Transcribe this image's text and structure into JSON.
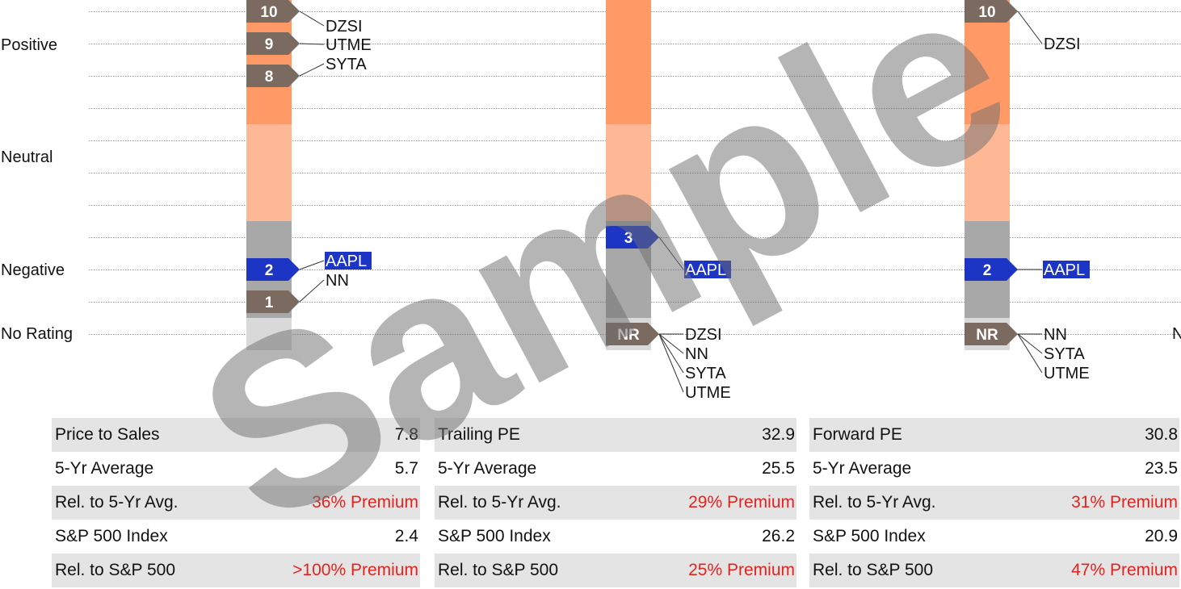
{
  "chart_data": {
    "type": "valuation-rating-columns",
    "rating_labels": [
      "Positive",
      "Neutral",
      "Negative",
      "No Rating"
    ],
    "cut_left": "N",
    "columns": [
      {
        "markers": [
          {
            "label": "10",
            "value": 10,
            "kind": "brown",
            "tickers": [
              "DZSI"
            ]
          },
          {
            "label": "9",
            "value": 9,
            "kind": "brown",
            "tickers": [
              "UTME"
            ]
          },
          {
            "label": "8",
            "value": 8,
            "kind": "brown",
            "tickers": [
              "SYTA"
            ]
          },
          {
            "label": "2",
            "value": 2,
            "kind": "blue",
            "tickers": [
              "AAPL"
            ]
          },
          {
            "label": "1",
            "value": 1,
            "kind": "brown",
            "tickers": [
              "NN"
            ]
          }
        ]
      },
      {
        "markers": [
          {
            "label": "3",
            "value": 3,
            "kind": "blue",
            "tickers": [
              "AAPL"
            ]
          },
          {
            "label": "NR",
            "value": 0,
            "kind": "brown",
            "tickers": [
              "DZSI",
              "NN",
              "SYTA",
              "UTME"
            ]
          }
        ]
      },
      {
        "markers": [
          {
            "label": "10",
            "value": 10,
            "kind": "brown",
            "tickers": [
              "DZSI"
            ]
          },
          {
            "label": "2",
            "value": 2,
            "kind": "blue",
            "tickers": [
              "AAPL"
            ]
          },
          {
            "label": "NR",
            "value": 0,
            "kind": "brown",
            "tickers": [
              "NN",
              "SYTA",
              "UTME"
            ]
          }
        ]
      }
    ],
    "highlight_ticker": "AAPL",
    "watermark": "Sample",
    "colors": {
      "positive": "#ff9966",
      "neutral": "#ffb896",
      "negative": "#a8a8a8",
      "norating": "#d9d9d9",
      "marker_brown": "#7a6a60",
      "marker_blue": "#1c35c4",
      "premium_red": "#e3231e",
      "table_shade": "#e4e4e4"
    }
  },
  "tables": [
    {
      "rows": [
        {
          "label": "Price to Sales",
          "value": "7.8"
        },
        {
          "label": "5-Yr Average",
          "value": "5.7"
        },
        {
          "label": "Rel. to 5-Yr Avg.",
          "value": "36% Premium"
        },
        {
          "label": "S&P 500 Index",
          "value": "2.4"
        },
        {
          "label": "Rel. to S&P 500",
          "value": ">100% Premium"
        }
      ]
    },
    {
      "rows": [
        {
          "label": "Trailing PE",
          "value": "32.9"
        },
        {
          "label": "5-Yr Average",
          "value": "25.5"
        },
        {
          "label": "Rel. to 5-Yr Avg.",
          "value": "29% Premium"
        },
        {
          "label": "S&P 500 Index",
          "value": "26.2"
        },
        {
          "label": "Rel. to S&P 500",
          "value": "25% Premium"
        }
      ]
    },
    {
      "rows": [
        {
          "label": "Forward PE",
          "value": "30.8"
        },
        {
          "label": "5-Yr Average",
          "value": "23.5"
        },
        {
          "label": "Rel. to 5-Yr Avg.",
          "value": "31% Premium"
        },
        {
          "label": "S&P 500 Index",
          "value": "20.9"
        },
        {
          "label": "Rel. to S&P 500",
          "value": "47% Premium"
        }
      ]
    }
  ]
}
